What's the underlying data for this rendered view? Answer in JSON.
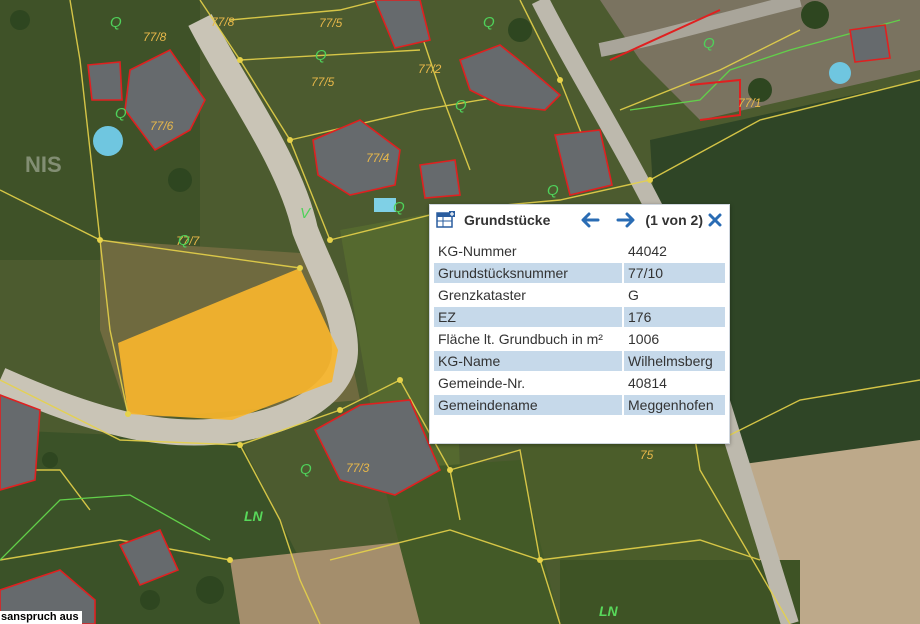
{
  "map": {
    "parcel_labels": [
      "77/8",
      "77/5",
      "77/6",
      "77/5",
      "77/2",
      "77/4",
      "77/7",
      "77/1",
      "77/3",
      "75",
      "77/8"
    ],
    "landuse_labels": [
      "Q",
      "Q",
      "Q",
      "Q",
      "Q",
      "Q",
      "Q",
      "Q",
      "V",
      "Q",
      "Q"
    ],
    "ln_labels": [
      "LN",
      "LN"
    ],
    "watermark_text": "NIS",
    "colors": {
      "highlight": "#f7b52c",
      "parcel_line": "#e6d24a",
      "building": "#e02020"
    }
  },
  "popup": {
    "title": "Grundstücke",
    "counter": "(1 von 2)",
    "prev_icon": "arrow-left-icon",
    "next_icon": "arrow-right-icon",
    "close_icon": "close-icon",
    "rows": [
      {
        "key": "KG-Nummer",
        "value": "44042"
      },
      {
        "key": "Grundstücksnummer",
        "value": "77/10"
      },
      {
        "key": "Grenzkataster",
        "value": "G"
      },
      {
        "key": "EZ",
        "value": "176"
      },
      {
        "key": "Fläche lt. Grundbuch in m²",
        "value": "1006"
      },
      {
        "key": "KG-Name",
        "value": "Wilhelmsberg"
      },
      {
        "key": "Gemeinde-Nr.",
        "value": "40814"
      },
      {
        "key": "Gemeindename",
        "value": "Meggenhofen"
      }
    ]
  },
  "disclaimer": "sanspruch aus"
}
